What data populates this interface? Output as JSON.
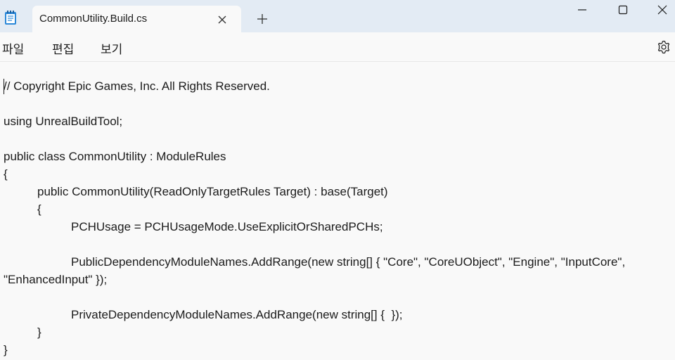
{
  "window": {
    "tab_title": "CommonUtility.Build.cs"
  },
  "menu": {
    "file": "파일",
    "edit": "편집",
    "view": "보기"
  },
  "icons": {
    "app": "notepad-icon",
    "tab_close": "close-icon",
    "new_tab": "plus-icon",
    "minimize": "minimize-icon",
    "maximize": "maximize-icon",
    "close": "close-icon",
    "settings": "gear-icon"
  },
  "editor": {
    "lines": [
      "// Copyright Epic Games, Inc. All Rights Reserved.",
      "",
      "using UnrealBuildTool;",
      "",
      "public class CommonUtility : ModuleRules",
      "{",
      "public CommonUtility(ReadOnlyTargetRules Target) : base(Target)",
      "{",
      "PCHUsage = PCHUsageMode.UseExplicitOrSharedPCHs;",
      "",
      "PublicDependencyModuleNames.AddRange(new string[] { \"Core\", \"CoreUObject\", \"Engine\", \"InputCore\",",
      "\"EnhancedInput\" });",
      "",
      "PrivateDependencyModuleNames.AddRange(new string[] {  });",
      "}",
      "}"
    ]
  }
}
